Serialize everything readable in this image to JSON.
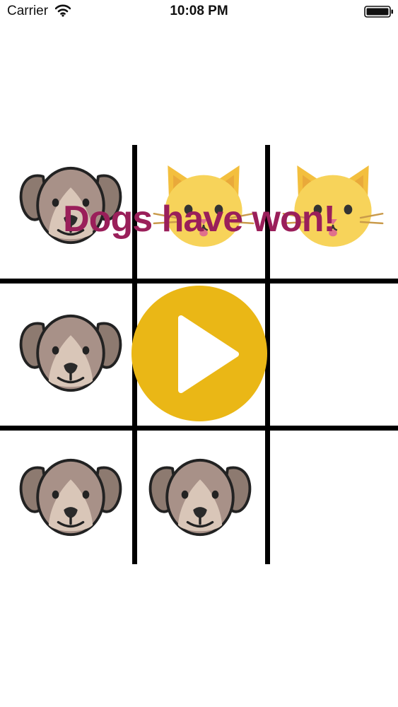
{
  "status_bar": {
    "carrier": "Carrier",
    "time": "10:08 PM"
  },
  "game": {
    "banner": "Dogs have won!",
    "board": [
      [
        "dog",
        "cat",
        "cat"
      ],
      [
        "dog",
        "",
        ""
      ],
      [
        "dog",
        "dog",
        ""
      ]
    ],
    "colors": {
      "banner": "#9a1f5a",
      "play_button": "#eab716",
      "grid": "#000000"
    }
  },
  "icons": {
    "dog": "dog-face-icon",
    "cat": "cat-face-icon",
    "play": "play-icon"
  }
}
